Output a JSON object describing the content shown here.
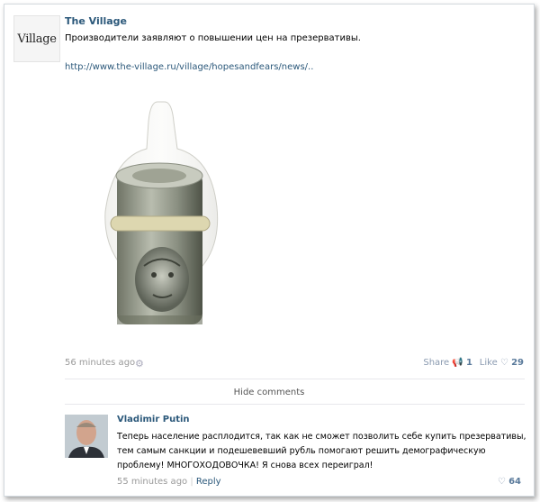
{
  "post": {
    "author": "The Village",
    "logo_text": "Village",
    "text": "Производители заявляют о повышении цен на презервативы.",
    "link": "http://www.the-village.ru/village/hopesandfears/news/..",
    "time": "56 minutes ago",
    "share_label": "Share",
    "share_count": "1",
    "like_label": "Like",
    "like_count": "29"
  },
  "comments": {
    "hide_label": "Hide comments",
    "items": [
      {
        "author": "Vladimir Putin",
        "text": "Теперь население расплодится, так как не сможет позволить себе купить презервативы, тем самым санкции и подешевевший рубль помогают решить демографическую проблему! МНОГОХОДОВОЧКА! Я снова всех переиграл!",
        "time": "55 minutes ago",
        "reply_label": "Reply",
        "like_count": "64"
      }
    ]
  },
  "colors": {
    "link": "#2b587a",
    "muted": "#999999",
    "border": "#d3d9de"
  },
  "icons": [
    "gear-icon",
    "megaphone-icon",
    "heart-icon"
  ]
}
